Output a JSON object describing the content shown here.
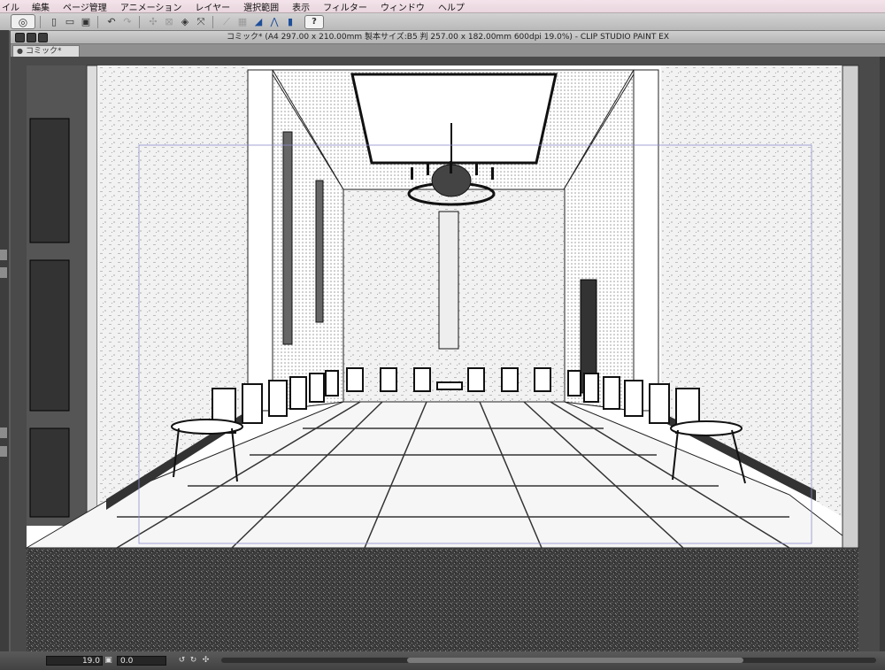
{
  "menu": {
    "items": [
      "イル",
      "編集",
      "ページ管理",
      "アニメーション",
      "レイヤー",
      "選択範囲",
      "表示",
      "フィルター",
      "ウィンドウ",
      "ヘルプ"
    ]
  },
  "toolbar": {
    "icons": [
      "clip-studio-logo-icon",
      "new-file-icon",
      "open-file-icon",
      "save-icon",
      "undo-icon",
      "redo-icon",
      "transform-icon",
      "clear-icon",
      "fill-icon",
      "scale-icon",
      "snap-ruler-icon",
      "snap-grid-icon",
      "snap-special-ruler-icon",
      "help-icon"
    ],
    "help_label": "?"
  },
  "window": {
    "title": "コミック* (A4 297.00 x 210.00mm 製本サイズ:B5 判 257.00 x 182.00mm 600dpi 19.0%)  - CLIP STUDIO PAINT EX"
  },
  "tab": {
    "label": "コミック*",
    "close_icon": "close-icon"
  },
  "canvas": {
    "description_icon": "manga-canvas-artwork"
  },
  "status": {
    "zoom": "19.0",
    "angle": "0.0"
  },
  "colors": {
    "menubar": "#f0e0e6",
    "toolbar": "#c4c4c4",
    "workspace": "#4a4a4a",
    "accent_blue": "#1f4f9a"
  }
}
